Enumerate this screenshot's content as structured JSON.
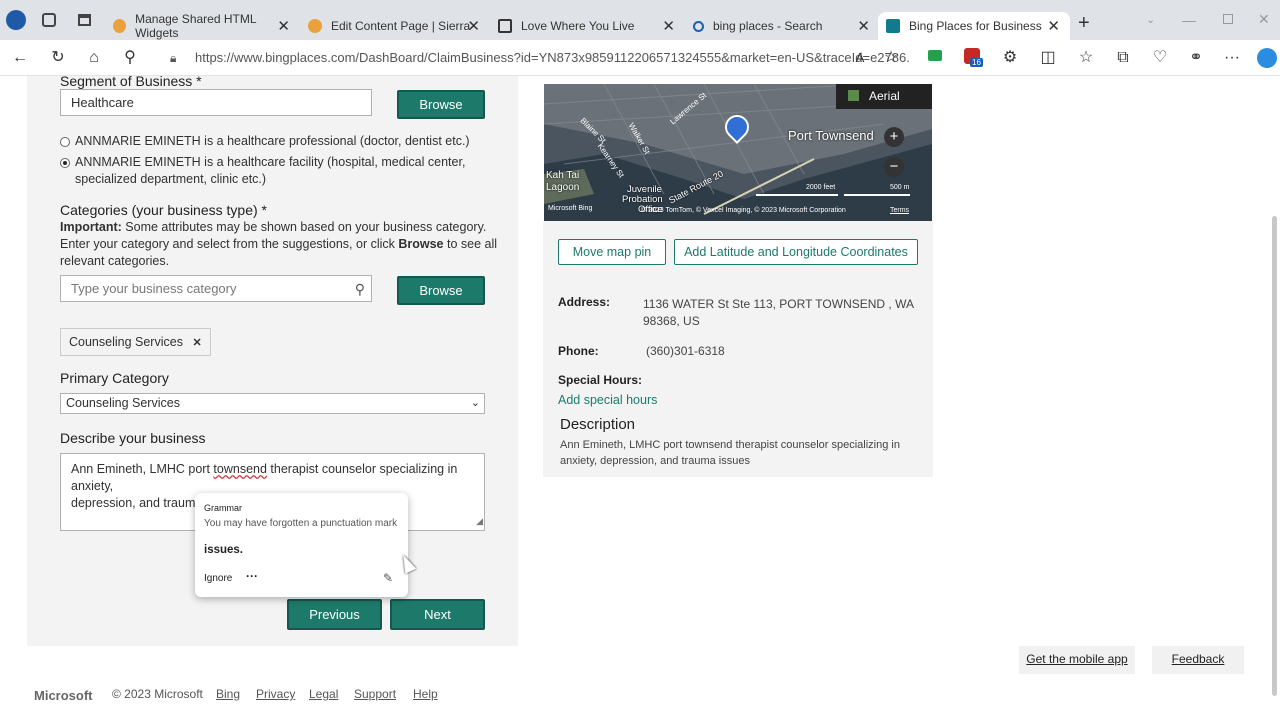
{
  "tabs": [
    {
      "title": "Manage Shared HTML Widgets",
      "active": false
    },
    {
      "title": "Edit Content Page | Sierra Intera",
      "active": false
    },
    {
      "title": "Love Where You Live",
      "active": false
    },
    {
      "title": "bing places - Search",
      "active": false
    },
    {
      "title": "Bing Places for Business",
      "active": true
    }
  ],
  "address": {
    "url": "https://www.bingplaces.com/DashBoard/ClaimBusiness?id=YN873x9859112206571324555&market=en-US&traceId=e2786..."
  },
  "form": {
    "segment_label": "Segment of Business *",
    "segment_value": "Healthcare",
    "browse_label": "Browse",
    "radio1": "ANNMARIE EMINETH is a healthcare professional (doctor, dentist etc.)",
    "radio2_line1": "ANNMARIE EMINETH is a healthcare facility (hospital, medical center,",
    "radio2_line2": "specialized department, clinic etc.)",
    "categories_label": "Categories (your business type) *",
    "important_bold": "Important:",
    "important_line1": " Some attributes may be shown based on your business category.",
    "important_line2a": "Enter your category and select from the suggestions, or click ",
    "important_line2b": "Browse",
    "important_line2c": " to see all",
    "important_line3": "relevant categories.",
    "category_placeholder": "Type your business category",
    "selected_tag": "Counseling Services",
    "primary_label": "Primary Category",
    "primary_value": "Counseling Services",
    "describe_label": "Describe your business",
    "describe_line1a": "Ann Emineth, LMHC port ",
    "describe_line1b": "townsend",
    "describe_line1c": " therapist counselor specializing in anxiety,",
    "describe_line2a": "depression, and trauma ",
    "describe_line2b": "issues",
    "previous_label": "Previous",
    "next_label": "Next"
  },
  "grammar_popup": {
    "title": "Grammar",
    "message": "You may have forgotten a punctuation mark",
    "suggestion": "issues.",
    "ignore_label": "Ignore",
    "more_label": "···"
  },
  "map": {
    "aerial_label": "Aerial",
    "city_label": "Port Townsend",
    "lagoon_line1": "Kah Tai",
    "lagoon_line2": "Lagoon",
    "juvenile_line1": "Juvenile",
    "juvenile_line2": "Probation",
    "juvenile_line3": "Office",
    "route_label": "State Route 20",
    "street1": "Blaine St",
    "street2": "Walker St",
    "street3": "Kearney St",
    "street4": "Lawrence St",
    "scale_feet": "2000 feet",
    "scale_m": "500 m",
    "bing_logo": "Microsoft Bing",
    "copyright": "© 2023 TomTom, © Vexcel Imaging, © 2023 Microsoft Corporation",
    "terms": "Terms",
    "zoom_in": "+",
    "zoom_out": "−"
  },
  "info": {
    "move_pin_label": "Move map pin",
    "add_coords_label": "Add Latitude and Longitude Coordinates",
    "address_label": "Address:",
    "address_line1": "1136 WATER St Ste 113, PORT TOWNSEND , WA",
    "address_line2": "98368, US",
    "phone_label": "Phone:",
    "phone_value": "(360)301-6318",
    "special_hours_label": "Special Hours:",
    "add_special_hours": "Add special hours",
    "description_heading": "Description",
    "description_line1": "Ann Emineth, LMHC port townsend therapist counselor specializing in",
    "description_line2": "anxiety, depression, and trauma issues"
  },
  "footer": {
    "brand": "Microsoft",
    "copyright": "© 2023 Microsoft",
    "links": [
      "Bing",
      "Privacy",
      "Legal",
      "Support",
      "Help"
    ],
    "mobile_app": "Get the mobile app",
    "feedback": "Feedback"
  },
  "colors": {
    "accent": "#1d7a6b",
    "panel": "#f3f3f3",
    "tabbar": "#dfe3e8"
  }
}
